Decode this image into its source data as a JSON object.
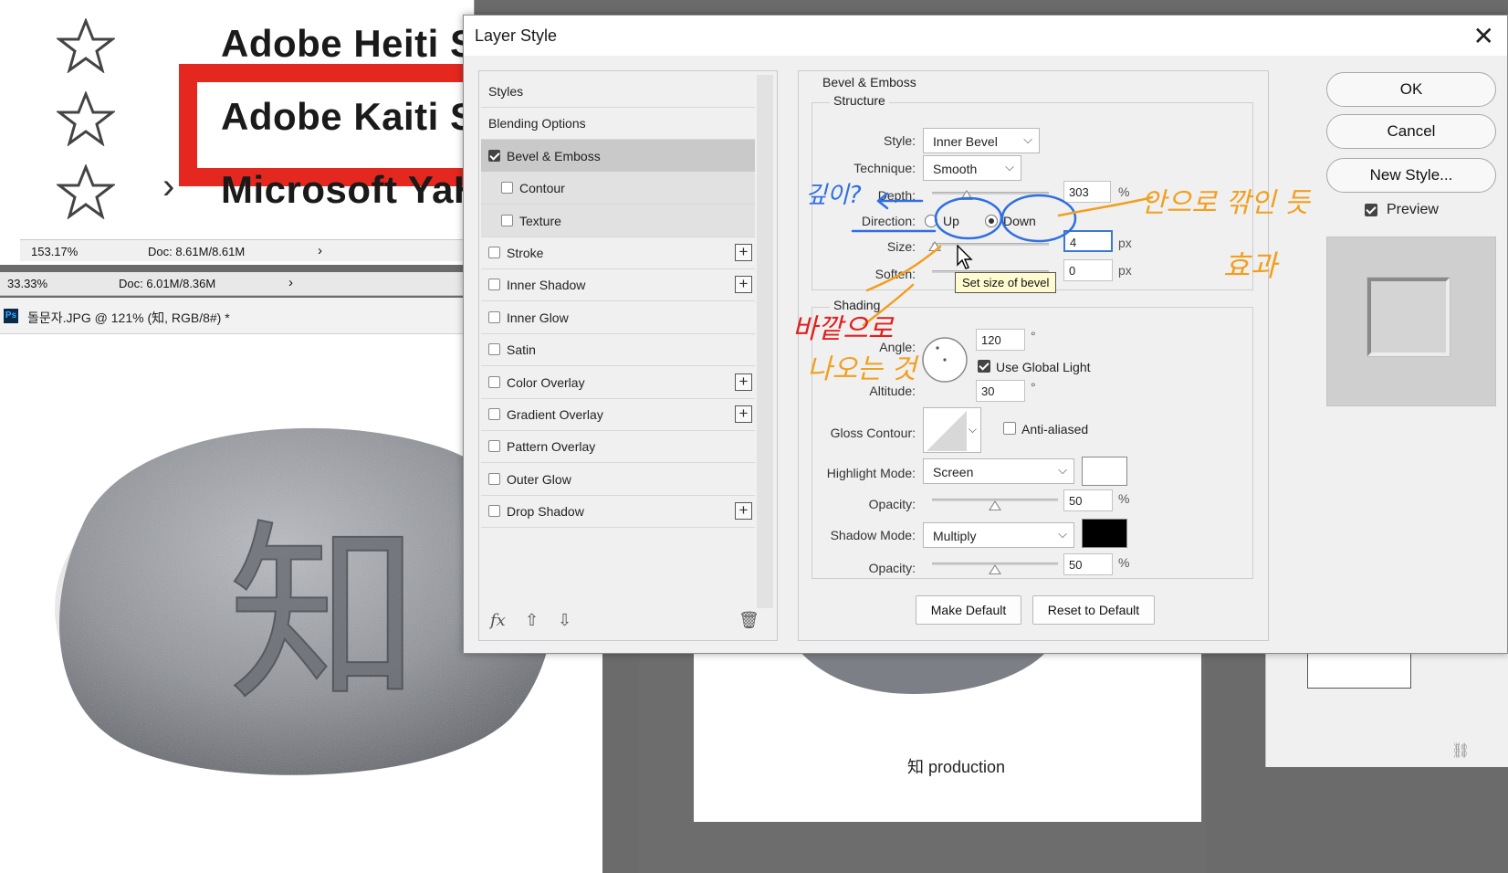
{
  "background": {
    "fonts": [
      {
        "name": "Adobe Heiti St"
      },
      {
        "name": "Adobe Kaiti St"
      },
      {
        "name": "Microsoft YaHe"
      }
    ],
    "status1": {
      "zoom": "153.17%",
      "doc": "Doc: 8.61M/8.61M"
    },
    "status2": {
      "zoom": "33.33%",
      "doc": "Doc: 6.01M/8.36M"
    },
    "doc_tab": {
      "title": "돌문자.JPG @ 121% (知, RGB/8#) *",
      "app_icon": "Ps"
    },
    "stone_glyph": "知",
    "production_label": "知 production"
  },
  "dialog": {
    "title": "Layer Style",
    "styles_list": [
      {
        "label": "Styles",
        "has_checkbox": false,
        "checked": false,
        "plus": false
      },
      {
        "label": "Blending Options",
        "has_checkbox": false,
        "checked": false,
        "plus": false
      },
      {
        "label": "Bevel & Emboss",
        "has_checkbox": true,
        "checked": true,
        "plus": false,
        "selected": true
      },
      {
        "label": "Contour",
        "has_checkbox": true,
        "checked": false,
        "plus": false,
        "sub": true
      },
      {
        "label": "Texture",
        "has_checkbox": true,
        "checked": false,
        "plus": false,
        "sub": true
      },
      {
        "label": "Stroke",
        "has_checkbox": true,
        "checked": false,
        "plus": true
      },
      {
        "label": "Inner Shadow",
        "has_checkbox": true,
        "checked": false,
        "plus": true
      },
      {
        "label": "Inner Glow",
        "has_checkbox": true,
        "checked": false,
        "plus": false
      },
      {
        "label": "Satin",
        "has_checkbox": true,
        "checked": false,
        "plus": false
      },
      {
        "label": "Color Overlay",
        "has_checkbox": true,
        "checked": false,
        "plus": true
      },
      {
        "label": "Gradient Overlay",
        "has_checkbox": true,
        "checked": false,
        "plus": true
      },
      {
        "label": "Pattern Overlay",
        "has_checkbox": true,
        "checked": false,
        "plus": false
      },
      {
        "label": "Outer Glow",
        "has_checkbox": true,
        "checked": false,
        "plus": false
      },
      {
        "label": "Drop Shadow",
        "has_checkbox": true,
        "checked": false,
        "plus": true
      }
    ],
    "footer": {
      "fx": "fx",
      "up": "⇧",
      "down": "⇩",
      "trash": "🗑"
    },
    "bevel": {
      "group_title": "Bevel & Emboss",
      "structure_title": "Structure",
      "style_label": "Style:",
      "style_value": "Inner Bevel",
      "technique_label": "Technique:",
      "technique_value": "Smooth",
      "depth_label": "Depth:",
      "depth_value": "303",
      "depth_unit": "%",
      "depth_level": 0.3,
      "direction_label": "Direction:",
      "direction_up": "Up",
      "direction_down": "Down",
      "direction_selected": "Down",
      "size_label": "Size:",
      "size_value": "4",
      "size_unit": "px",
      "size_level": 0.02,
      "soften_label": "Soften:",
      "soften_value": "0",
      "soften_unit": "px",
      "tooltip": "Set size of bevel"
    },
    "shading": {
      "title": "Shading",
      "angle_label": "Angle:",
      "angle_value": "120",
      "angle_unit": "°",
      "global_light_label": "Use Global Light",
      "global_light_checked": true,
      "altitude_label": "Altitude:",
      "altitude_value": "30",
      "altitude_unit": "°",
      "gloss_label": "Gloss Contour:",
      "anti_aliased_label": "Anti-aliased",
      "anti_aliased_checked": false,
      "highlight_mode_label": "Highlight Mode:",
      "highlight_mode_value": "Screen",
      "highlight_color": "#ffffff",
      "highlight_opacity_label": "Opacity:",
      "highlight_opacity_value": "50",
      "highlight_opacity_unit": "%",
      "highlight_opacity_level": 0.5,
      "shadow_mode_label": "Shadow Mode:",
      "shadow_mode_value": "Multiply",
      "shadow_color": "#000000",
      "shadow_opacity_label": "Opacity:",
      "shadow_opacity_value": "50",
      "shadow_opacity_unit": "%",
      "shadow_opacity_level": 0.5
    },
    "buttons": {
      "make_default": "Make Default",
      "reset_default": "Reset to Default",
      "ok": "OK",
      "cancel": "Cancel",
      "new_style": "New Style...",
      "preview_label": "Preview",
      "preview_checked": true
    }
  },
  "annotations": {
    "depth_note": "깊이?",
    "direction_note": "안으로 깎인 듯",
    "effect_note": "효과",
    "reverse_note_1": "바깥으로",
    "reverse_note_2": "나오는 것",
    "colors": {
      "blue": "#2f6fe0",
      "orange": "#f0a020",
      "red": "#e02020"
    }
  }
}
